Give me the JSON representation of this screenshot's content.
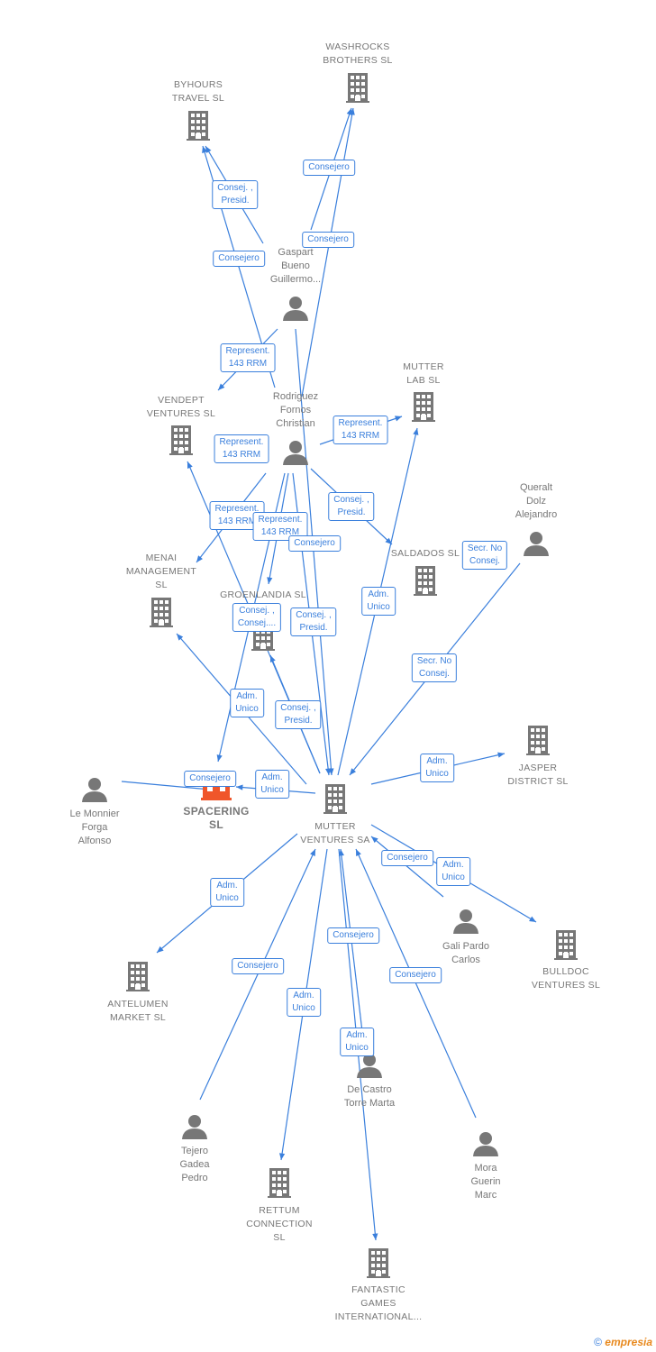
{
  "colors": {
    "edge": "#3a7fdc",
    "node": "#777777",
    "focus": "#f0562a"
  },
  "nodes": [
    {
      "id": "washrocks",
      "type": "company",
      "lines": [
        "WASHROCKS",
        "BROTHERS  SL"
      ]
    },
    {
      "id": "byhours",
      "type": "company",
      "lines": [
        "BYHOURS",
        "TRAVEL  SL"
      ]
    },
    {
      "id": "gaspart",
      "type": "person",
      "lines": [
        "Gaspart",
        "Bueno",
        "Guillermo..."
      ]
    },
    {
      "id": "vendept",
      "type": "company",
      "lines": [
        "VENDEPT",
        "VENTURES  SL"
      ]
    },
    {
      "id": "rodriguez",
      "type": "person",
      "lines": [
        "Rodriguez",
        "Fornos",
        "Christian"
      ]
    },
    {
      "id": "mutterlab",
      "type": "company",
      "lines": [
        "MUTTER",
        "LAB  SL"
      ]
    },
    {
      "id": "queralt",
      "type": "person",
      "lines": [
        "Queralt",
        "Dolz",
        "Alejandro"
      ]
    },
    {
      "id": "saldados",
      "type": "company",
      "lines": [
        "SALDADOS  SL"
      ]
    },
    {
      "id": "menai",
      "type": "company",
      "lines": [
        "MENAI",
        "MANAGEMENT",
        "SL"
      ]
    },
    {
      "id": "groenlandia",
      "type": "company",
      "lines": [
        "GROENLANDIA  SL"
      ]
    },
    {
      "id": "jasper",
      "type": "company",
      "lines": [
        "JASPER",
        "DISTRICT  SL"
      ]
    },
    {
      "id": "lemonnier",
      "type": "person",
      "lines": [
        "Le Monnier",
        "Forga",
        "Alfonso"
      ]
    },
    {
      "id": "spacering",
      "type": "focus",
      "lines": [
        "SPACERING",
        "SL"
      ]
    },
    {
      "id": "mutterventures",
      "type": "company",
      "lines": [
        "MUTTER",
        "VENTURES SA"
      ]
    },
    {
      "id": "gali",
      "type": "person",
      "lines": [
        "Gali Pardo",
        "Carlos"
      ]
    },
    {
      "id": "bulldoc",
      "type": "company",
      "lines": [
        "BULLDOC",
        "VENTURES  SL"
      ]
    },
    {
      "id": "antelumen",
      "type": "company",
      "lines": [
        "ANTELUMEN",
        "MARKET  SL"
      ]
    },
    {
      "id": "decastro",
      "type": "person",
      "lines": [
        "De Castro",
        "Torre Marta"
      ]
    },
    {
      "id": "tejero",
      "type": "person",
      "lines": [
        "Tejero",
        "Gadea",
        "Pedro"
      ]
    },
    {
      "id": "mora",
      "type": "person",
      "lines": [
        "Mora",
        "Guerin",
        "Marc"
      ]
    },
    {
      "id": "rettum",
      "type": "company",
      "lines": [
        "RETTUM",
        "CONNECTION",
        "SL"
      ]
    },
    {
      "id": "fantastic",
      "type": "company",
      "lines": [
        "FANTASTIC",
        "GAMES",
        "INTERNATIONAL..."
      ]
    }
  ],
  "edge_labels": [
    [
      "Consejero"
    ],
    [
      "Consej. ,",
      "Presid."
    ],
    [
      "Consejero"
    ],
    [
      "Consejero"
    ],
    [
      "Represent.",
      "143 RRM"
    ],
    [
      "Represent.",
      "143 RRM"
    ],
    [
      "Represent.",
      "143 RRM"
    ],
    [
      "Consej. ,",
      "Presid."
    ],
    [
      "Represent.",
      "143 RRM"
    ],
    [
      "Represent.",
      "143 RRM"
    ],
    [
      "Consejero"
    ],
    [
      "Secr.  No",
      "Consej."
    ],
    [
      "Adm.",
      "Unico"
    ],
    [
      "Consej. ,",
      "Consej...."
    ],
    [
      "Consej. ,",
      "Presid."
    ],
    [
      "Secr.  No",
      "Consej."
    ],
    [
      "Adm.",
      "Unico"
    ],
    [
      "Consej. ,",
      "Presid."
    ],
    [
      "Adm.",
      "Unico"
    ],
    [
      "Consejero"
    ],
    [
      "Adm.",
      "Unico"
    ],
    [
      "Consejero"
    ],
    [
      "Adm.",
      "Unico"
    ],
    [
      "Adm.",
      "Unico"
    ],
    [
      "Consejero"
    ],
    [
      "Consejero"
    ],
    [
      "Consejero"
    ],
    [
      "Adm.",
      "Unico"
    ],
    [
      "Adm.",
      "Unico"
    ]
  ],
  "copyright": {
    "symbol": "©",
    "brand": "empresia"
  }
}
